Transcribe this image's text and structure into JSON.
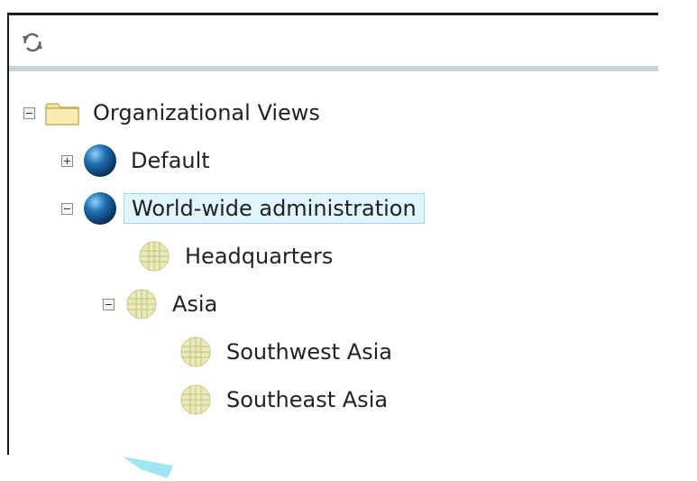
{
  "toolbar": {
    "refresh_icon": "refresh-icon"
  },
  "tree": {
    "root": {
      "label": "Organizational Views",
      "icon": "folder-icon",
      "expanded": true
    },
    "default": {
      "label": "Default",
      "icon": "globe-icon",
      "expanded": false
    },
    "world_wide": {
      "label": "World-wide administration",
      "icon": "globe-icon",
      "expanded": true,
      "selected": true
    },
    "headquarters": {
      "label": "Headquarters",
      "icon": "site-grid-icon"
    },
    "asia": {
      "label": "Asia",
      "icon": "site-grid-icon",
      "expanded": true
    },
    "southwest_asia": {
      "label": "Southwest Asia",
      "icon": "site-grid-icon"
    },
    "southeast_asia": {
      "label": "Southeast Asia",
      "icon": "site-grid-icon"
    }
  },
  "colors": {
    "selection_bg": "#dff4fb",
    "selection_border": "#9fd6ea",
    "toolbar_separator": "#c9d3dc",
    "globe_blue": "#1f6fb3",
    "site_icon": "#e9ebb9",
    "folder": "#f3e59b"
  }
}
